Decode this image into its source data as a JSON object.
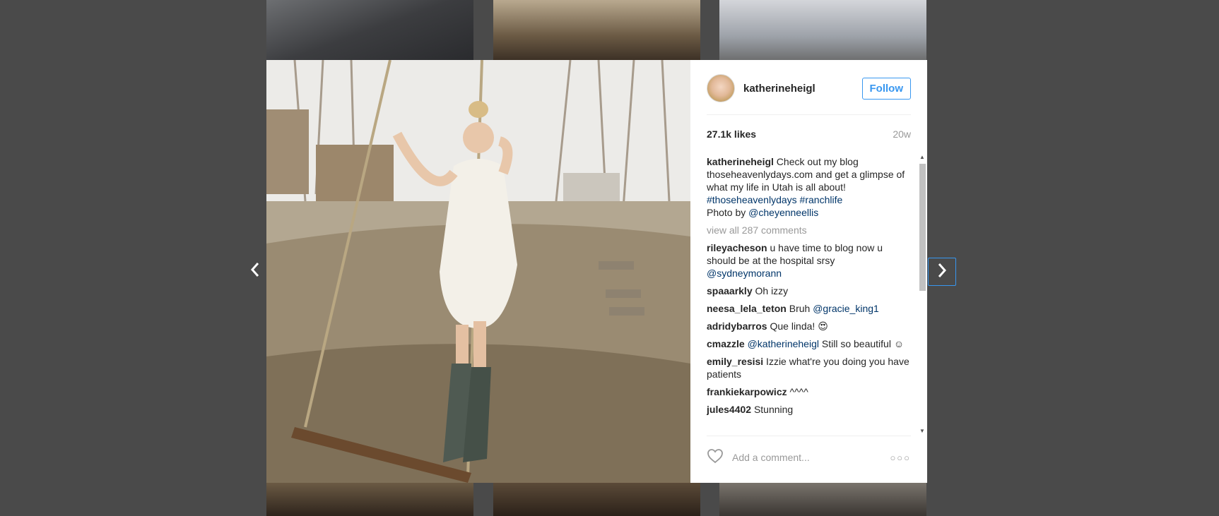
{
  "post": {
    "username": "katherineheigl",
    "follow_label": "Follow",
    "likes": "27.1k likes",
    "time_ago": "20w",
    "caption": {
      "user": "katherineheigl",
      "text_1": " Check out my blog thoseheavenlydays.com and get a glimpse of what my life in Utah is all about! ",
      "hashtag_1": "#thoseheavenlydays",
      "hashtag_2": "#ranchlife",
      "text_2": "Photo by ",
      "mention": "@cheyenneellis"
    },
    "view_all": "view all 287 comments",
    "comments": [
      {
        "user": "rileyacheson",
        "text": " u have time to blog now u should be at the hospital srsy ",
        "mention": "@sydneymorann",
        "tail": ""
      },
      {
        "user": "spaaarkly",
        "text": " Oh izzy",
        "mention": "",
        "tail": ""
      },
      {
        "user": "neesa_lela_teton",
        "text": " Bruh ",
        "mention": "@gracie_king1",
        "tail": ""
      },
      {
        "user": "adridybarros",
        "text": " Que linda! 😍",
        "mention": "",
        "tail": ""
      },
      {
        "user": "cmazzle",
        "text": " ",
        "mention": "@katherineheigl",
        "tail": " Still so beautiful ☺"
      },
      {
        "user": "emily_resisi",
        "text": " Izzie what're you doing you have patients",
        "mention": "",
        "tail": ""
      },
      {
        "user": "frankiekarpowicz",
        "text": " ^^^^",
        "mention": "",
        "tail": ""
      },
      {
        "user": "jules4402",
        "text": " Stunning",
        "mention": "",
        "tail": ""
      }
    ],
    "comment_placeholder": "Add a comment...",
    "more_label": "○○○"
  },
  "icons": {
    "prev": "chevron-left-icon",
    "next": "chevron-right-icon",
    "like": "heart-icon",
    "more": "more-options-icon"
  },
  "colors": {
    "accent": "#3897f0",
    "mention": "#003569",
    "muted": "#999999"
  }
}
